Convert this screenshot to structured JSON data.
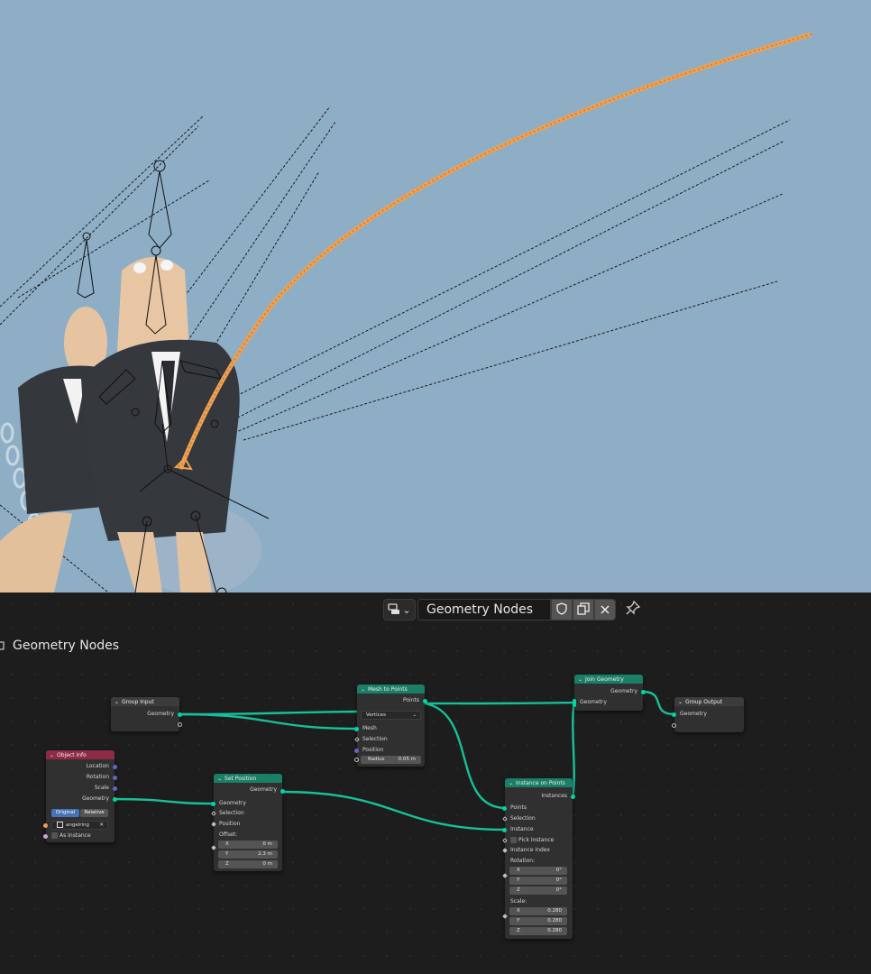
{
  "header": {
    "tree_name": "Geometry Nodes",
    "editor_type_icon": "node-tree-icon",
    "fake_user_icon": "shield-icon",
    "duplicate_icon": "duplicate-icon",
    "unlink_icon": "close-icon",
    "pin_icon": "pin-icon"
  },
  "breadcrumb": {
    "label": "Geometry Nodes"
  },
  "colors": {
    "viewport_bg": "#8eaec6",
    "editor_bg": "#1d1d1d",
    "geometry_socket": "#00d6a3",
    "geometry_node_header": "#1b7e66",
    "object_node_header": "#8d2a45",
    "selection_outline": "#f0a050",
    "active_button": "#4772b3"
  },
  "nodes": {
    "group_input": {
      "title": "Group Input",
      "outputs": [
        "Geometry"
      ]
    },
    "object_info": {
      "title": "Object Info",
      "outputs": [
        "Location",
        "Rotation",
        "Scale",
        "Geometry"
      ],
      "mode_options": [
        "Original",
        "Relative"
      ],
      "mode_selected": "Original",
      "object_value": "angelring",
      "as_instance_label": "As Instance"
    },
    "mesh_to_points": {
      "title": "Mesh to Points",
      "output": "Points",
      "mode": "Vertices",
      "inputs": [
        "Mesh",
        "Selection",
        "Position"
      ],
      "radius_label": "Radius",
      "radius_value": "0.05 m"
    },
    "set_position": {
      "title": "Set Position",
      "output": "Geometry",
      "inputs": [
        "Geometry",
        "Selection",
        "Position"
      ],
      "offset_label": "Offset:",
      "offset": [
        {
          "axis": "X",
          "value": "0 m"
        },
        {
          "axis": "Y",
          "value": "2.3 m"
        },
        {
          "axis": "Z",
          "value": "0 m"
        }
      ]
    },
    "instance_on_points": {
      "title": "Instance on Points",
      "output": "Instances",
      "inputs": [
        "Points",
        "Selection",
        "Instance"
      ],
      "pick_instance": "Pick Instance",
      "instance_index": "Instance Index",
      "rotation_label": "Rotation:",
      "rotation": [
        {
          "axis": "X",
          "value": "0°"
        },
        {
          "axis": "Y",
          "value": "0°"
        },
        {
          "axis": "Z",
          "value": "0°"
        }
      ],
      "scale_label": "Scale:",
      "scale": [
        {
          "axis": "X",
          "value": "0.280"
        },
        {
          "axis": "Y",
          "value": "0.280"
        },
        {
          "axis": "Z",
          "value": "0.280"
        }
      ]
    },
    "join_geometry": {
      "title": "Join Geometry",
      "output": "Geometry",
      "input": "Geometry"
    },
    "group_output": {
      "title": "Group Output",
      "input": "Geometry"
    }
  }
}
